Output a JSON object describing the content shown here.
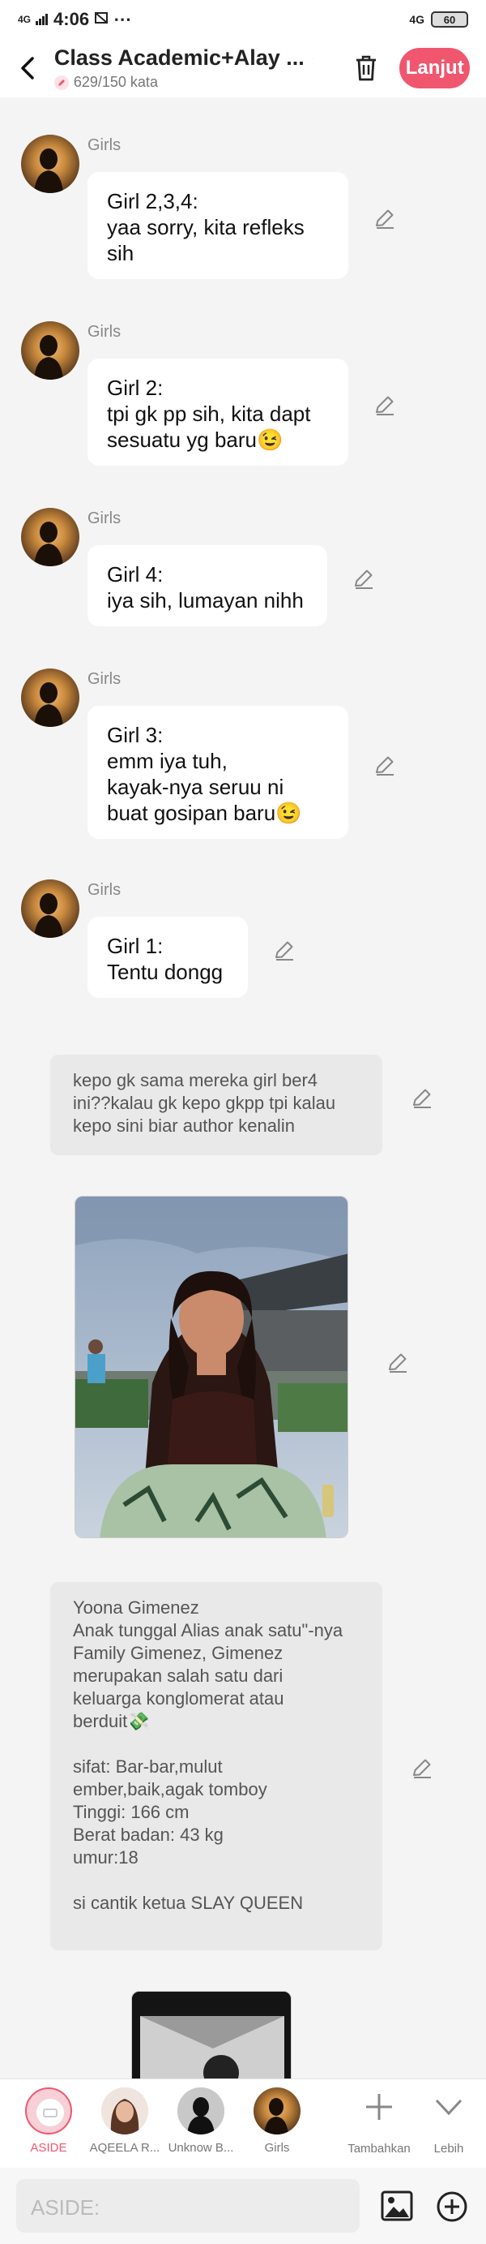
{
  "status_bar": {
    "time": "4:06",
    "network_left": "4G",
    "network_right": "4G",
    "battery": "60",
    "indicators": "⋯"
  },
  "header": {
    "title": "Class Academic+Alay ...",
    "word_count": "629/150 kata",
    "next_label": "Lanjut"
  },
  "messages": [
    {
      "speaker": "Girls",
      "text": "Girl 2,3,4:\nyaa sorry, kita refleks\nsih"
    },
    {
      "speaker": "Girls",
      "text": "Girl 2:\ntpi gk pp sih, kita dapt\nsesuatu yg baru😉"
    },
    {
      "speaker": "Girls",
      "text": "Girl 4:\niya sih, lumayan nihh"
    },
    {
      "speaker": "Girls",
      "text": "Girl 3:\nemm iya tuh,\nkayak-nya seruu ni\nbuat gosipan baru😉"
    },
    {
      "speaker": "Girls",
      "text": "Girl 1:\nTentu dongg"
    }
  ],
  "narrations": [
    "kepo gk sama mereka girl ber4\nini??kalau gk kepo gkpp tpi kalau\nkepo sini biar author kenalin",
    "Yoona Gimenez\nAnak tunggal Alias anak satu\"-nya\nFamily Gimenez, Gimenez\nmerupakan salah satu dari\nkeluarga konglomerat atau\nberduit💸\n\nsifat: Bar-bar,mulut\nember,baik,agak tomboy\nTinggi: 166 cm\nBerat badan: 43 kg\numur:18\n\nsi cantik ketua SLAY QUEEN"
  ],
  "characters": [
    {
      "label": "ASIDE"
    },
    {
      "label": "AQEELA R..."
    },
    {
      "label": "Unknow B..."
    },
    {
      "label": "Girls"
    },
    {
      "label": "Tambahkan"
    },
    {
      "label": "Lebih"
    }
  ],
  "input": {
    "placeholder": "ASIDE:"
  },
  "colors": {
    "accent": "#f0576f",
    "bubble": "#ffffff",
    "narration": "#e9e9e9",
    "background": "#f4f4f4"
  }
}
